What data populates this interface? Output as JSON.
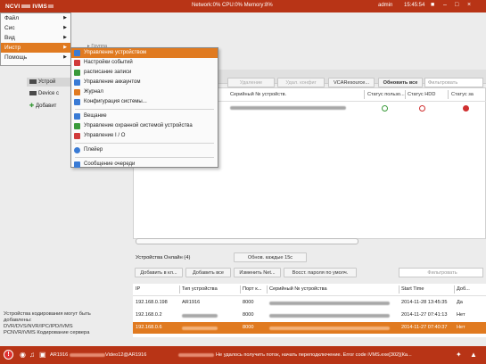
{
  "topbar": {
    "logo": "NCVI",
    "logo_suffix": "IVMS",
    "sysinfo": "Network:0% CPU:0% Memory:8%",
    "user": "admin",
    "time": "15:45:54"
  },
  "menu": {
    "items": [
      {
        "label": "Файл",
        "has_sub": true
      },
      {
        "label": "Сис",
        "has_sub": true
      },
      {
        "label": "Вид",
        "has_sub": true
      },
      {
        "label": "Инстр",
        "has_sub": true
      },
      {
        "label": "Помощь",
        "has_sub": true
      }
    ]
  },
  "submenu": {
    "items": [
      {
        "label": "Управление устройством",
        "color": "#3a7bd5",
        "active": true
      },
      {
        "label": "Настройки событий",
        "color": "#d03a3a"
      },
      {
        "label": "расписание записи",
        "color": "#3a9a3a"
      },
      {
        "label": "Управление аккаунтом",
        "color": "#3a7bd5"
      },
      {
        "label": "Журнал",
        "color": "#e07a20"
      },
      {
        "label": "Конфигурация системы...",
        "color": "#3a7bd5"
      },
      {
        "label": "Вещание",
        "color": "#3a7bd5"
      },
      {
        "label": "Управление охранной системой устройства",
        "color": "#3a9a3a"
      },
      {
        "label": "Управление I / O",
        "color": "#d03a3a"
      },
      {
        "label": "Плейер",
        "color": "#3a7bd5"
      },
      {
        "label": "Сообщение очереди",
        "color": "#3a7bd5"
      }
    ]
  },
  "tree": {
    "item1": "Устрой",
    "item2": "Device c",
    "item3": "Добавит"
  },
  "toolbar_upper": {
    "delete": "Удаление",
    "remote_config": "Удал. конфиг",
    "vca": "VCAResource...",
    "refresh_all": "Обновить все",
    "filter_placeholder": "Фильтровать"
  },
  "upper_headers": {
    "serial": "Серийный № устройств.",
    "status_user": "Статус пользо...",
    "status_hdd": "Статус HDD",
    "status_rec": "Статус за"
  },
  "lower": {
    "online_label": "Устройства Онлайн (4)",
    "refresh_every": "Обнов. каждые 15с",
    "add_to_client": "Добавить в кл...",
    "add_all": "Добавить все",
    "modify_net": "Изменить Net...",
    "reset_password": "Восст. пароля по умолч.",
    "filter_placeholder": "Фильтровать",
    "headers": {
      "ip": "IP",
      "type": "Тип устройства",
      "port": "Порт к...",
      "serial": "Серийный № устройства",
      "start": "Start Time",
      "added": "Доб..."
    },
    "rows": [
      {
        "ip": "192.168.0.198",
        "type": "AR1916",
        "port": "8000",
        "start": "2014-11-28 13:45:35",
        "added": "Да"
      },
      {
        "ip": "192.168.0.2",
        "type": "",
        "port": "8000",
        "start": "2014-11-27 07:41:13",
        "added": "Нет"
      },
      {
        "ip": "192.168.0.6",
        "type": "",
        "port": "8000",
        "start": "2014-11-27 07:40:37",
        "added": "Нет"
      }
    ]
  },
  "encoder_note": {
    "line1": "Устройства кодирования могут быть",
    "line2": "добавлены:",
    "line3": "DVR/DVS/NVR/IPC/IPD/iVMS",
    "line4": "PCNVR/iVMS Кодирование сервера"
  },
  "statusbar": {
    "device": "AR1916",
    "video": "Video12@AR1916",
    "message": "Не удалось получить поток, начать переподключение. Error code iVMS.exe[302](Ка..."
  },
  "colors": {
    "brand": "#b83416",
    "accent": "#e07a20"
  }
}
